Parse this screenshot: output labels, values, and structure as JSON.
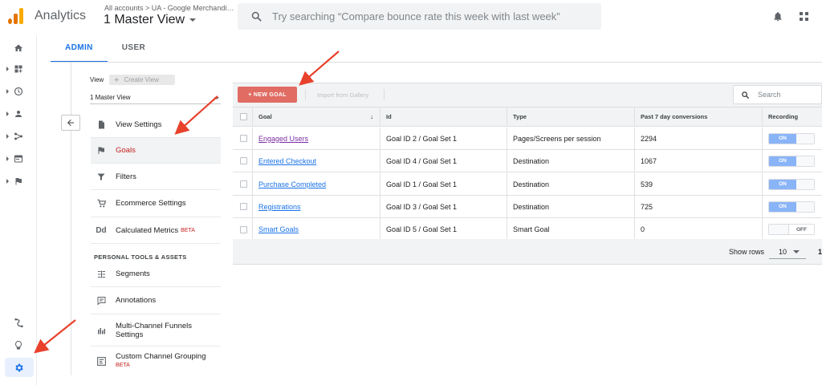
{
  "app": {
    "title": "Analytics",
    "breadcrumb": "All accounts > UA - Google Merchandi…",
    "view_selector": "1 Master View"
  },
  "search": {
    "placeholder": "Try searching “Compare bounce rate this week with last week”"
  },
  "header_icons": [
    "bell-icon",
    "apps-grid-icon"
  ],
  "rail": {
    "items": [
      "home-icon",
      "dashboard-icon",
      "clock-icon",
      "person-icon",
      "acquisition-icon",
      "behavior-icon",
      "flag-icon"
    ],
    "bottom": [
      "attribution-icon",
      "lightbulb-icon",
      "admin-gear-icon"
    ]
  },
  "tabs": [
    {
      "label": "ADMIN",
      "active": true
    },
    {
      "label": "USER",
      "active": false
    }
  ],
  "view_panel": {
    "view_label": "View",
    "create_view": "Create View",
    "selected_view": "1 Master View",
    "menu": [
      {
        "label": "View Settings",
        "icon": "document-icon",
        "active": false
      },
      {
        "label": "Goals",
        "icon": "flag-icon",
        "active": true
      },
      {
        "label": "Filters",
        "icon": "filter-icon",
        "active": false
      },
      {
        "label": "Ecommerce Settings",
        "icon": "cart-icon",
        "active": false
      },
      {
        "label": "Calculated Metrics",
        "icon": "dd-icon",
        "active": false,
        "badge": "BETA"
      }
    ],
    "section_title": "PERSONAL TOOLS & ASSETS",
    "tools": [
      {
        "label": "Segments",
        "icon": "segments-icon"
      },
      {
        "label": "Annotations",
        "icon": "annotation-icon"
      },
      {
        "label": "Multi-Channel Funnels",
        "label2": "Settings",
        "icon": "bar-chart-icon"
      },
      {
        "label": "Custom Channel Grouping",
        "icon": "channel-grouping-icon",
        "badge": "BETA"
      }
    ]
  },
  "goals": {
    "new_goal_label": "+ NEW GOAL",
    "import_label": "Import from Gallery",
    "search_placeholder": "Search",
    "columns": [
      "Goal",
      "Id",
      "Type",
      "Past 7 day conversions",
      "Recording"
    ],
    "rows": [
      {
        "goal": "Engaged Users",
        "id": "Goal ID 2 / Goal Set 1",
        "type": "Pages/Screens per session",
        "conversions": "2294",
        "recording": "ON",
        "visited": true
      },
      {
        "goal": "Entered Checkout",
        "id": "Goal ID 4 / Goal Set 1",
        "type": "Destination",
        "conversions": "1067",
        "recording": "ON",
        "visited": false
      },
      {
        "goal": "Purchase Completed",
        "id": "Goal ID 1 / Goal Set 1",
        "type": "Destination",
        "conversions": "539",
        "recording": "ON",
        "visited": false
      },
      {
        "goal": "Registrations",
        "id": "Goal ID 3 / Goal Set 1",
        "type": "Destination",
        "conversions": "725",
        "recording": "ON",
        "visited": false
      },
      {
        "goal": "Smart Goals",
        "id": "Goal ID 5 / Goal Set 1",
        "type": "Smart Goal",
        "conversions": "0",
        "recording": "OFF",
        "visited": false
      }
    ],
    "show_rows_label": "Show rows",
    "rows_per_page": "10",
    "page": "1"
  },
  "colors": {
    "accent": "#1a73e8",
    "new_goal": "#e06c63",
    "active_menu_text": "#c5221f",
    "annotation_arrow": "#e8412c"
  }
}
